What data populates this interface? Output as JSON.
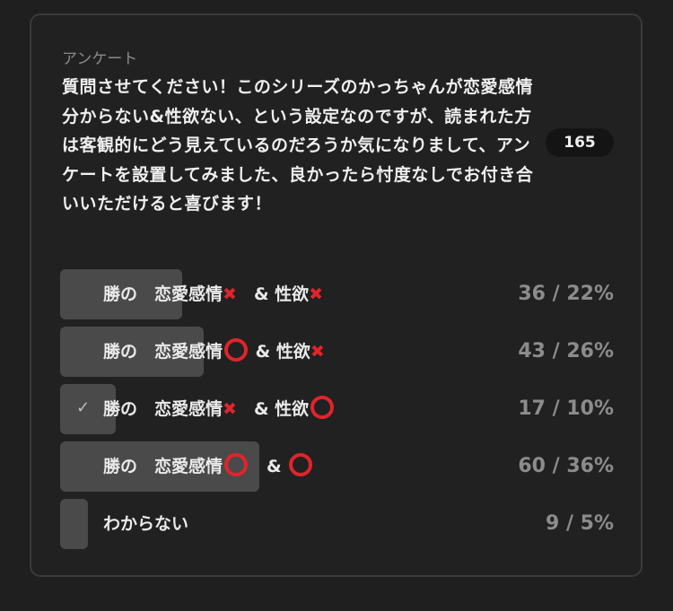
{
  "poll": {
    "label": "アンケート",
    "question": "質問させてください！このシリーズのかっちゃんが恋愛感情分からない&性欲ない、という設定なのですが、読まれた方は客観的にどう見えているのだろうか気になりまして、アンケートを設置してみました、良かったら忖度なしでお付き合いいただけると喜びます！",
    "total_votes": "165",
    "options": [
      {
        "prefix": "勝の　恋愛感情",
        "mark1": "cross",
        "mid": "　& 性欲",
        "mark2": "cross",
        "result": "36 / 22%",
        "percent": 22,
        "selected": false
      },
      {
        "prefix": "勝の　恋愛感情",
        "mark1": "circle",
        "mid": " & 性欲",
        "mark2": "cross",
        "result": "43 / 26%",
        "percent": 26,
        "selected": false
      },
      {
        "prefix": "勝の　恋愛感情",
        "mark1": "cross",
        "mid": "　& 性欲",
        "mark2": "circle",
        "result": "17 / 10%",
        "percent": 10,
        "selected": true
      },
      {
        "prefix": "勝の　恋愛感情",
        "mark1": "circle",
        "mid": "　& ",
        "mark2": "circle",
        "result": "60 / 36%",
        "percent": 36,
        "selected": false
      },
      {
        "prefix": "わからない",
        "mark1": "",
        "mid": "",
        "mark2": "",
        "result": "9 / 5%",
        "percent": 5,
        "selected": false
      }
    ],
    "colors": {
      "bar": "#4a4a4a",
      "mark": "#e0242b"
    },
    "icons": {
      "selected": "check-icon",
      "cross": "cross-mark-icon",
      "circle": "circle-mark-icon"
    }
  }
}
